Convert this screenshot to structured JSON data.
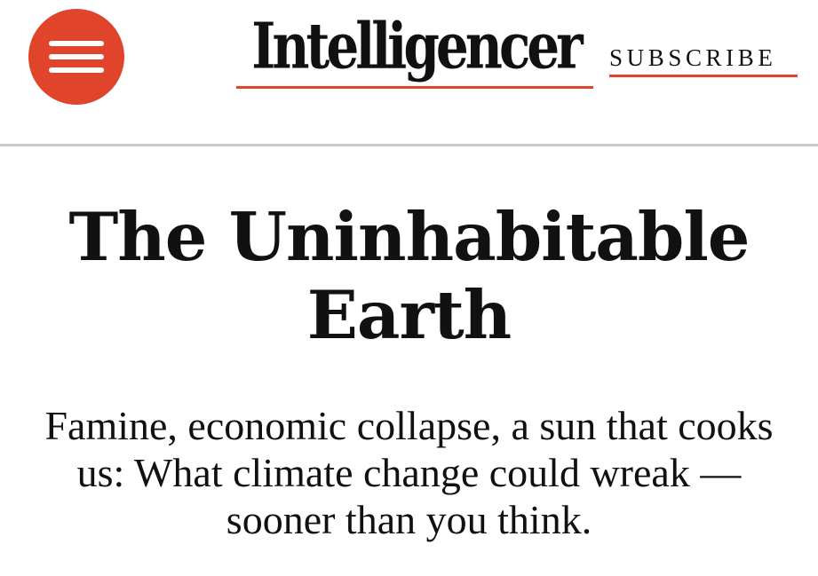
{
  "header": {
    "menu_icon": "hamburger-menu-icon",
    "logo_text": "Intelligencer",
    "subscribe_label": "SUBSCRIBE",
    "accent_color": "#e0442b"
  },
  "article": {
    "headline": "The Uninhabitable Earth",
    "dek": "Famine, economic collapse, a sun that cooks us: What climate change could wreak — sooner than you think."
  }
}
